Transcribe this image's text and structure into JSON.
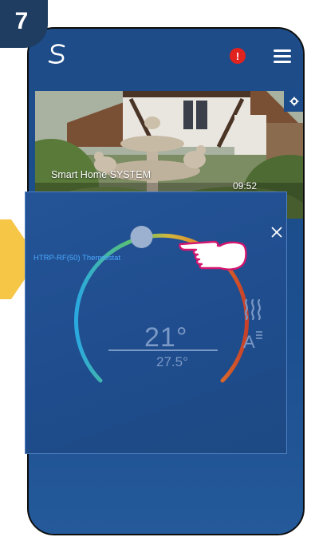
{
  "step": {
    "number": "7"
  },
  "header": {
    "logo_icon": "syxthsense-s-logo-icon",
    "alert_text": "!",
    "menu_icon": "hamburger-menu-icon"
  },
  "camera": {
    "title": "Smart Home SYSTEM",
    "time": "09:52",
    "status_icon": "check-icon",
    "settings_icon": "gear-icon"
  },
  "thermostat": {
    "title": "HTRP-RF(50) Thermostat",
    "current_temp": "21°",
    "set_temp": "27.5°",
    "level": 0.45,
    "heat_icon": "heating-waves-icon",
    "mode_icon": "auto-mode-icon",
    "close_icon": "close-icon"
  },
  "colors": {
    "phone_bg": "#1c4d8a",
    "badge_bg": "#1f3d60",
    "arrow": "#f6c646",
    "alert": "#e0231f",
    "check": "#59c23a",
    "hand_outline": "#d4166f",
    "title_blue": "#4aa8ff"
  }
}
